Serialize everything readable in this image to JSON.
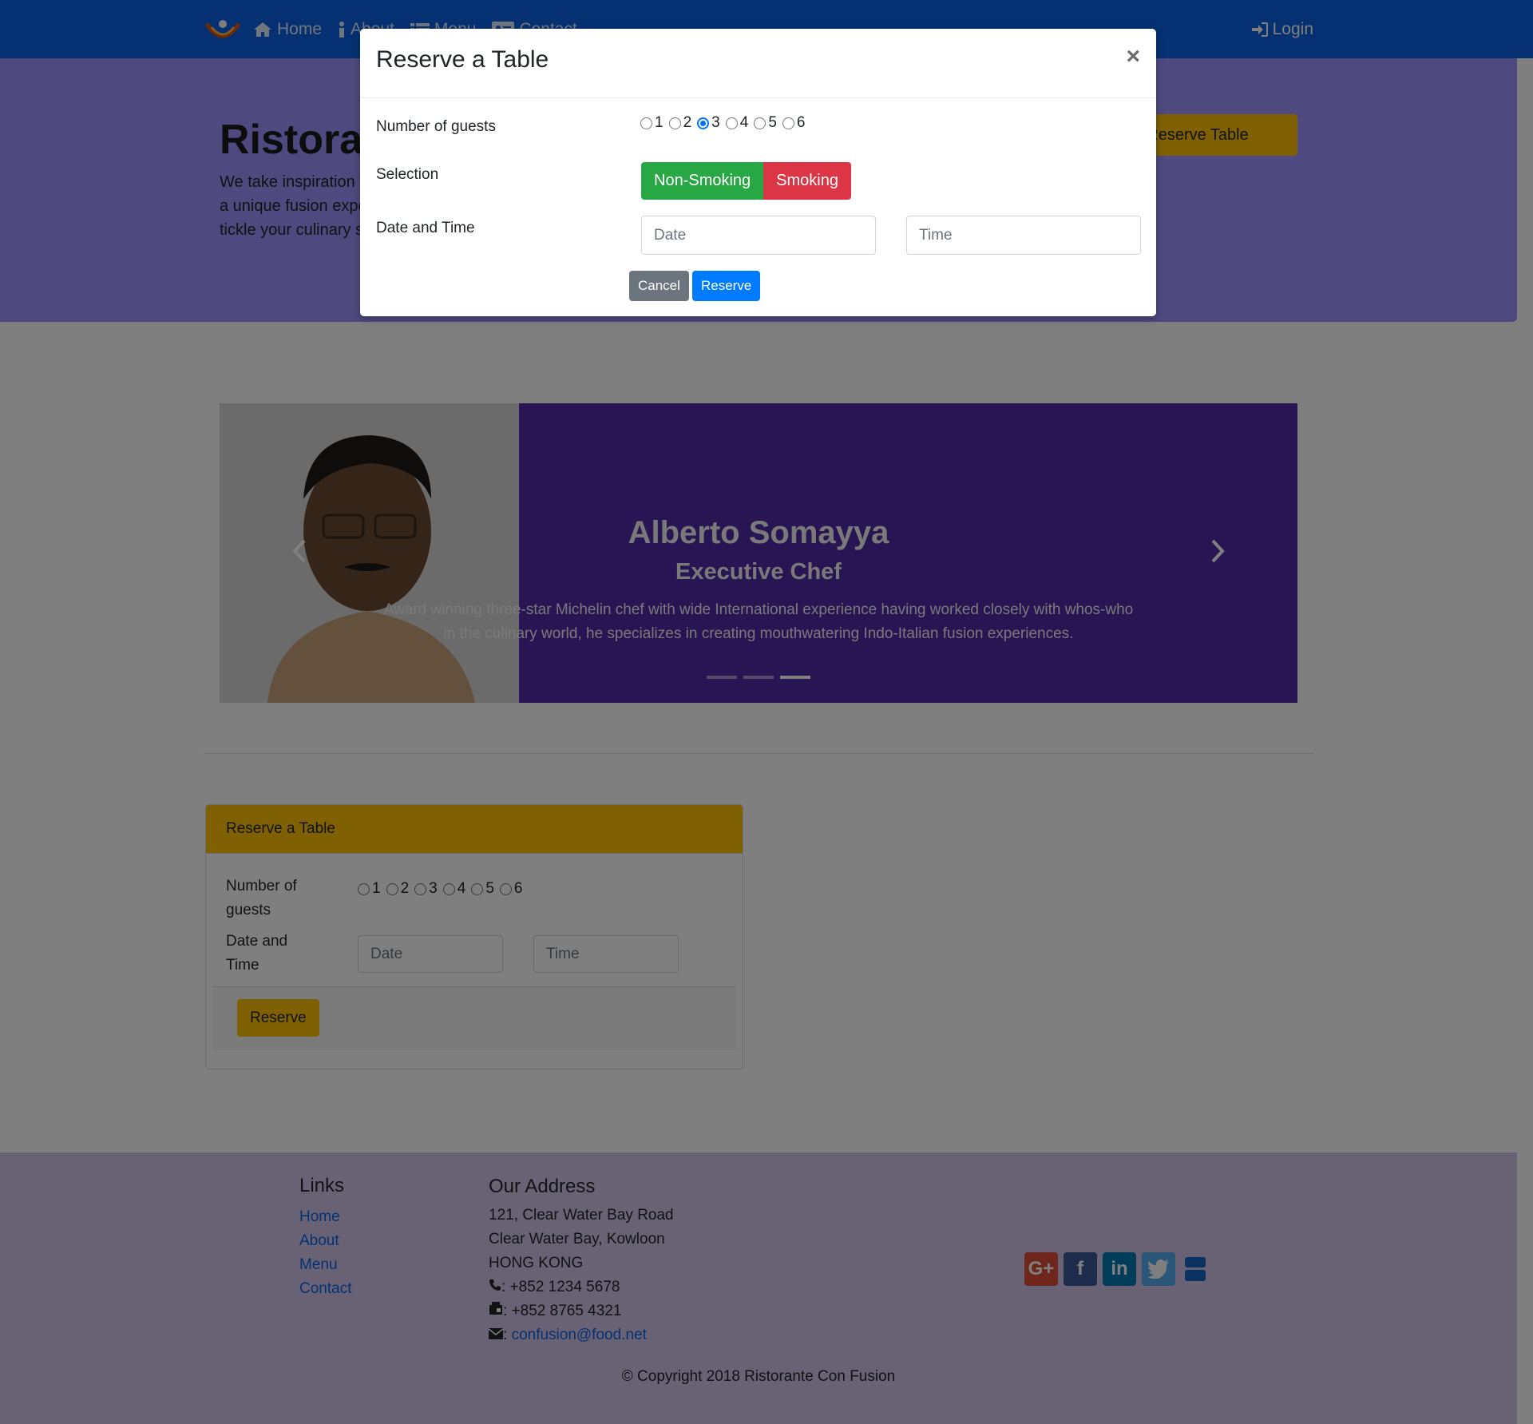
{
  "navbar": {
    "items": [
      {
        "label": "Home",
        "icon": "home-icon"
      },
      {
        "label": "About",
        "icon": "info-icon"
      },
      {
        "label": "Menu",
        "icon": "list-icon"
      },
      {
        "label": "Contact",
        "icon": "address-card-icon"
      }
    ],
    "login_label": "Login"
  },
  "jumbotron": {
    "title": "Ristorante con Fusion",
    "text": "We take inspiration from the World's best cuisines, and create a unique fusion experience. Our lipsmacking creations will tickle your culinary senses!",
    "button_label": "Reserve Table"
  },
  "carousel": {
    "name": "Alberto Somayya",
    "role": "Executive Chef",
    "description": "Award winning three-star Michelin chef with wide International experience having worked closely with whos-who in the culinary world, he specializes in creating mouthwatering Indo-Italian fusion experiences.",
    "active_index": 2,
    "slide_count": 3
  },
  "reserve_card": {
    "title": "Reserve a Table",
    "guests_label": "Number of guests",
    "guest_options": [
      "1",
      "2",
      "3",
      "4",
      "5",
      "6"
    ],
    "datetime_label": "Date and Time",
    "date_placeholder": "Date",
    "time_placeholder": "Time",
    "submit_label": "Reserve"
  },
  "modal": {
    "title": "Reserve a Table",
    "close_glyph": "×",
    "guests_label": "Number of guests",
    "guest_options": [
      "1",
      "2",
      "3",
      "4",
      "5",
      "6"
    ],
    "selected_guests": "3",
    "selection_label": "Selection",
    "non_smoking_label": "Non-Smoking",
    "smoking_label": "Smoking",
    "datetime_label": "Date and Time",
    "date_placeholder": "Date",
    "time_placeholder": "Time",
    "cancel_label": "Cancel",
    "reserve_label": "Reserve"
  },
  "footer": {
    "links_title": "Links",
    "links": [
      "Home",
      "About",
      "Menu",
      "Contact"
    ],
    "address_title": "Our Address",
    "address_lines": [
      "121, Clear Water Bay Road",
      "Clear Water Bay, Kowloon",
      "HONG KONG"
    ],
    "phone": ": +852 1234 5678",
    "fax": ": +852 8765 4321",
    "email_prefix": ": ",
    "email": "confusion@food.net",
    "social": [
      "google-plus-icon",
      "facebook-icon",
      "linkedin-icon",
      "twitter-icon",
      "youtube-icon"
    ],
    "copyright": "© Copyright 2018 Ristorante Con Fusion"
  },
  "colors": {
    "navbar": "#0a63e6",
    "jumbotron": "#9d94ff",
    "carousel": "#512da8",
    "footer": "#d1c4e9",
    "warning": "#ffc107",
    "success": "#28a745",
    "danger": "#dc3545",
    "primary": "#007bff",
    "secondary": "#6c757d"
  }
}
